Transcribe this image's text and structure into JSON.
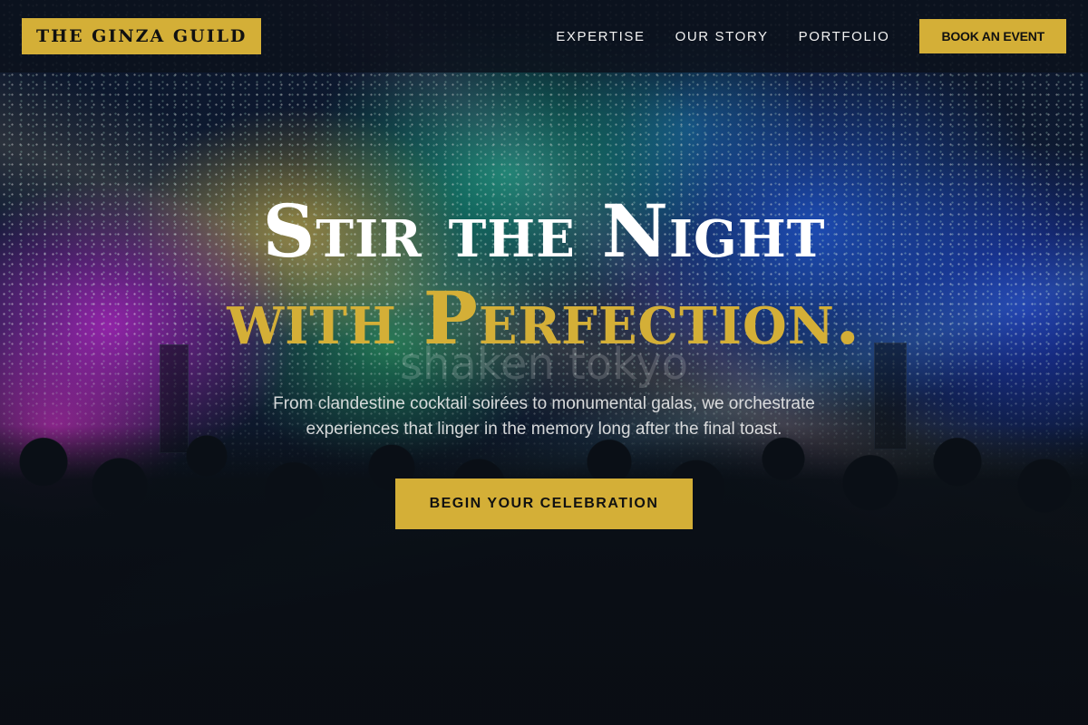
{
  "header": {
    "logo_text": "THE GINZA GUILD",
    "nav": [
      {
        "label": "EXPERTISE"
      },
      {
        "label": "OUR STORY"
      },
      {
        "label": "PORTFOLIO"
      }
    ],
    "cta_label": "BOOK AN EVENT"
  },
  "hero": {
    "title_line1": "Stir the Night",
    "title_line2": "with Perfection.",
    "watermark": "shaken tokyo",
    "subtitle": "From clandestine cocktail soirées to monumental galas, we orchestrate experiences that linger in the memory long after the final toast.",
    "cta_label": "BEGIN YOUR CELEBRATION",
    "background_image": "concert-crowd-confetti-stage-lights"
  },
  "colors": {
    "accent_gold": "#d4af37",
    "header_bg": "#0c121c",
    "text_light": "#ffffff"
  }
}
